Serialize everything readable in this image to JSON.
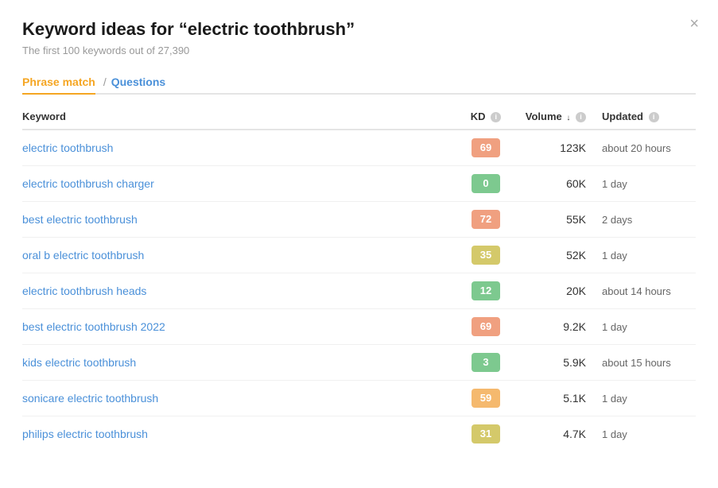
{
  "title": "Keyword ideas for “electric toothbrush”",
  "subtitle": "The first 100 keywords out of 27,390",
  "close_label": "×",
  "tabs": [
    {
      "label": "Phrase match",
      "active": true
    },
    {
      "separator": "/"
    },
    {
      "label": "Questions",
      "active": false
    }
  ],
  "table": {
    "columns": [
      {
        "label": "Keyword",
        "key": "keyword"
      },
      {
        "label": "KD",
        "key": "kd",
        "info": true
      },
      {
        "label": "Volume",
        "key": "volume",
        "info": true,
        "sort": true
      },
      {
        "label": "Updated",
        "key": "updated",
        "info": true
      }
    ],
    "rows": [
      {
        "keyword": "electric toothbrush",
        "kd": 69,
        "kd_class": "kd-red",
        "volume": "123K",
        "updated": "about 20 hours"
      },
      {
        "keyword": "electric toothbrush charger",
        "kd": 0,
        "kd_class": "kd-green",
        "volume": "60K",
        "updated": "1 day"
      },
      {
        "keyword": "best electric toothbrush",
        "kd": 72,
        "kd_class": "kd-red",
        "volume": "55K",
        "updated": "2 days"
      },
      {
        "keyword": "oral b electric toothbrush",
        "kd": 35,
        "kd_class": "kd-yellow",
        "volume": "52K",
        "updated": "1 day"
      },
      {
        "keyword": "electric toothbrush heads",
        "kd": 12,
        "kd_class": "kd-green",
        "volume": "20K",
        "updated": "about 14 hours"
      },
      {
        "keyword": "best electric toothbrush 2022",
        "kd": 69,
        "kd_class": "kd-red",
        "volume": "9.2K",
        "updated": "1 day"
      },
      {
        "keyword": "kids electric toothbrush",
        "kd": 3,
        "kd_class": "kd-green",
        "volume": "5.9K",
        "updated": "about 15 hours"
      },
      {
        "keyword": "sonicare electric toothbrush",
        "kd": 59,
        "kd_class": "kd-orange",
        "volume": "5.1K",
        "updated": "1 day"
      },
      {
        "keyword": "philips electric toothbrush",
        "kd": 31,
        "kd_class": "kd-yellow",
        "volume": "4.7K",
        "updated": "1 day"
      }
    ]
  }
}
